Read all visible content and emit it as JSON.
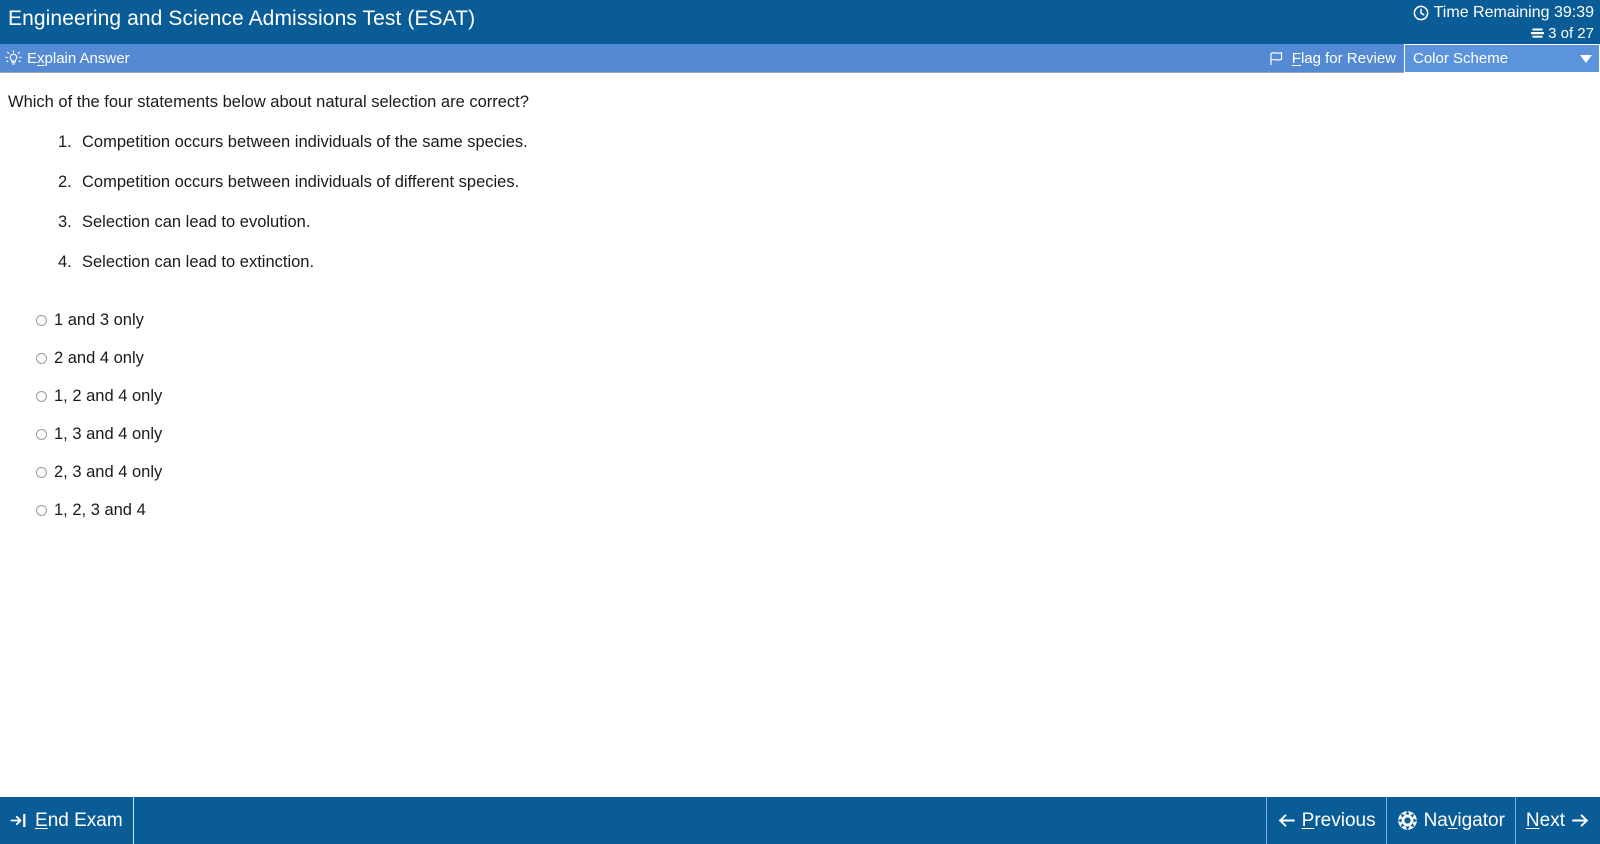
{
  "header": {
    "exam_title": "Engineering and Science Admissions Test (ESAT)",
    "time_remaining_label": "Time Remaining 39:39",
    "question_counter": "3 of 27",
    "clock_icon": "clock-icon",
    "stack_icon": "question-stack-icon"
  },
  "toolbar": {
    "explain_answer_prefix": "E",
    "explain_answer_accel": "x",
    "explain_answer_suffix": "plain Answer",
    "lightbulb_icon": "lightbulb-icon",
    "flag_accel": "F",
    "flag_suffix": "lag for Review",
    "flag_icon": "flag-icon",
    "color_scheme_label": "Color Scheme",
    "caret_icon": "chevron-down-icon"
  },
  "question": {
    "stem": "Which of the four statements below about natural selection are correct?",
    "statements": [
      {
        "num": "1.",
        "text": "Competition occurs between individuals of the same species."
      },
      {
        "num": "2.",
        "text": "Competition occurs between individuals of different species."
      },
      {
        "num": "3.",
        "text": "Selection can lead to evolution."
      },
      {
        "num": "4.",
        "text": "Selection can lead to extinction."
      }
    ],
    "options": [
      {
        "label": "1 and 3 only",
        "selected": false
      },
      {
        "label": "2 and 4 only",
        "selected": false
      },
      {
        "label": "1, 2 and 4 only",
        "selected": false
      },
      {
        "label": "1, 3 and 4 only",
        "selected": false
      },
      {
        "label": "2, 3 and 4 only",
        "selected": false
      },
      {
        "label": "1, 2, 3 and 4",
        "selected": false
      }
    ]
  },
  "footer": {
    "end_exam_accel": "E",
    "end_exam_suffix": "nd Exam",
    "end_exam_icon": "exit-icon",
    "previous_accel": "P",
    "previous_suffix": "revious",
    "previous_icon": "arrow-left-icon",
    "navigator_prefix": "Na",
    "navigator_accel": "v",
    "navigator_suffix": "igator",
    "navigator_icon": "navigator-icon",
    "next_accel": "N",
    "next_suffix": "ext",
    "next_icon": "arrow-right-icon"
  },
  "colors": {
    "header_blue": "#0a5c96",
    "toolbar_blue": "#548ad4",
    "dropdown_blue": "#5b94dd",
    "text_dark": "#1a1a1a"
  }
}
